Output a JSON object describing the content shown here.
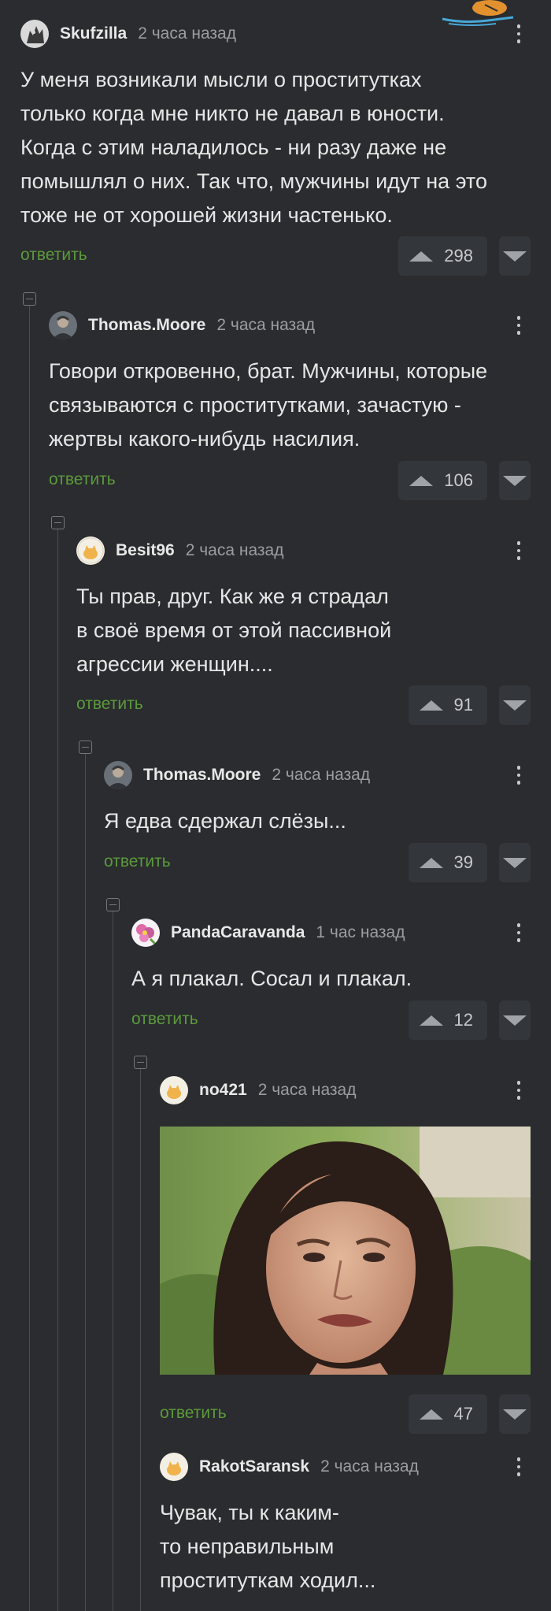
{
  "comments": [
    {
      "username": "Skufzilla",
      "time": "2 часа назад",
      "lines": [
        "У меня возникали мысли о проститутках",
        "только когда мне никто не давал в юности.",
        "Когда с этим наладилось - ни разу даже не",
        "помышлял о них. Так что, мужчины идут на это",
        "тоже не от хорошей жизни частенько."
      ],
      "reply": "ответить",
      "score": "298",
      "avatar_icon": "monster-avatar-icon"
    },
    {
      "username": "Thomas.Moore",
      "time": "2 часа назад",
      "lines": [
        "Говори откровенно, брат. Мужчины, которые",
        "связываются с проститутками, зачастую -",
        "жертвы какого-нибудь насилия."
      ],
      "reply": "ответить",
      "score": "106",
      "avatar_icon": "portrait-avatar-icon"
    },
    {
      "username": "Besit96",
      "time": "2 часа назад",
      "lines": [
        "Ты прав, друг. Как же я страдал",
        "в своё время от этой пассивной",
        "агрессии женщин...."
      ],
      "reply": "ответить",
      "score": "91",
      "avatar_icon": "cat-avatar-icon"
    },
    {
      "username": "Thomas.Moore",
      "time": "2 часа назад",
      "lines": [
        "Я едва сдержал слёзы..."
      ],
      "reply": "ответить",
      "score": "39",
      "avatar_icon": "portrait-avatar-icon"
    },
    {
      "username": "PandaCaravanda",
      "time": "1 час назад",
      "lines": [
        "А я плакал. Сосал и плакал."
      ],
      "reply": "ответить",
      "score": "12",
      "avatar_icon": "flower-avatar-icon"
    },
    {
      "username": "no421",
      "time": "2 часа назад",
      "lines": [],
      "reply": "ответить",
      "score": "47",
      "avatar_icon": "cat-avatar-icon",
      "image_icon": "woman-grimace-photo"
    },
    {
      "username": "RakotSaransk",
      "time": "2 часа назад",
      "lines": [
        "Чувак, ты к каким-",
        "то неправильным",
        "проституткам ходил..."
      ],
      "avatar_icon": "cat-avatar-icon"
    }
  ],
  "colors": {
    "background": "#2a2c2f",
    "reply_link": "#5c9a3b",
    "rating_bg": "#33363a"
  }
}
